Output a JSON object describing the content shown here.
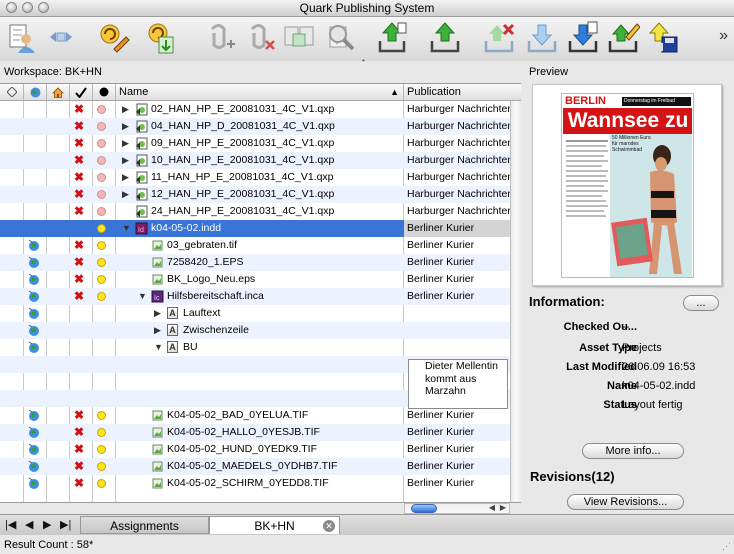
{
  "window": {
    "title": "Quark Publishing System"
  },
  "toolbar": {
    "buttons": [
      {
        "icon": "user-checklist-icon"
      },
      {
        "icon": "back-forward-icon"
      },
      {
        "icon": "refresh-edit-icon"
      },
      {
        "icon": "refresh-export-icon"
      },
      {
        "icon": "attach-add-icon"
      },
      {
        "icon": "attach-remove-icon"
      },
      {
        "icon": "compare-layout-icon"
      },
      {
        "icon": "check-document-icon"
      },
      {
        "icon": "search-icon"
      },
      {
        "icon": "check-in-upload-icon"
      },
      {
        "icon": "upload-icon"
      },
      {
        "icon": "cancel-upload-icon"
      },
      {
        "icon": "download-icon"
      },
      {
        "icon": "download-copy-icon"
      },
      {
        "icon": "edit-tray-icon"
      },
      {
        "icon": "save-upload-icon"
      }
    ],
    "more_label": "»"
  },
  "workspace_label": "Workspace: BK+HN",
  "preview_label": "Preview",
  "table": {
    "columns": {
      "name": "Name",
      "publication": "Publication"
    },
    "rows": [
      {
        "x": true,
        "dot": "pink",
        "indent": 0,
        "tri": "right",
        "icon": "qxp",
        "name": "02_HAN_HP_E_20081031_4C_V1.qxp",
        "pub": "Harburger Nachrichten"
      },
      {
        "x": true,
        "dot": "pink",
        "indent": 0,
        "tri": "right",
        "icon": "qxp",
        "name": "04_HAN_HP_D_20081031_4C_V1.qxp",
        "pub": "Harburger Nachrichten"
      },
      {
        "x": true,
        "dot": "pink",
        "indent": 0,
        "tri": "right",
        "icon": "qxp",
        "name": "09_HAN_HP_E_20081031_4C_V1.qxp",
        "pub": "Harburger Nachrichten"
      },
      {
        "x": true,
        "dot": "pink",
        "indent": 0,
        "tri": "right",
        "icon": "qxp",
        "name": "10_HAN_HP_E_20081031_4C_V1.qxp",
        "pub": "Harburger Nachrichten"
      },
      {
        "x": true,
        "dot": "pink",
        "indent": 0,
        "tri": "right",
        "icon": "qxp",
        "name": "11_HAN_HP_E_20081031_4C_V1.qxp",
        "pub": "Harburger Nachrichten"
      },
      {
        "x": true,
        "dot": "pink",
        "indent": 0,
        "tri": "right",
        "icon": "qxp",
        "name": "12_HAN_HP_E_20081031_4C_V1.qxp",
        "pub": "Harburger Nachrichten"
      },
      {
        "x": true,
        "dot": "pink",
        "indent": 0,
        "tri": "",
        "icon": "qxp",
        "name": "24_HAN_HP_E_20081031_4C_V1.qxp",
        "pub": "Harburger Nachrichten"
      },
      {
        "x": false,
        "dot": "yellow",
        "indent": 0,
        "tri": "down",
        "icon": "indd",
        "name": "k04-05-02.indd",
        "pub": "Berliner Kurier",
        "selected": true
      },
      {
        "x": true,
        "dot": "yellow",
        "indent": 1,
        "tri": "",
        "icon": "img",
        "name": "03_gebraten.tif",
        "pub": "Berliner Kurier",
        "globe": true
      },
      {
        "x": true,
        "dot": "yellow",
        "indent": 1,
        "tri": "",
        "icon": "img",
        "name": "7258420_1.EPS",
        "pub": "Berliner Kurier",
        "globe": true
      },
      {
        "x": true,
        "dot": "yellow",
        "indent": 1,
        "tri": "",
        "icon": "img",
        "name": "BK_Logo_Neu.eps",
        "pub": "Berliner Kurier",
        "globe": true
      },
      {
        "x": true,
        "dot": "yellow",
        "indent": 1,
        "tri": "down",
        "icon": "inca",
        "name": "Hilfsbereitschaft.inca",
        "pub": "Berliner Kurier",
        "globe": true
      },
      {
        "x": false,
        "dot": "",
        "indent": 2,
        "tri": "right",
        "icon": "a",
        "name": "Lauftext",
        "pub": "",
        "globe": true
      },
      {
        "x": false,
        "dot": "",
        "indent": 2,
        "tri": "right",
        "icon": "a",
        "name": "Zwischenzeile",
        "pub": "",
        "globe": true
      },
      {
        "x": false,
        "dot": "",
        "indent": 2,
        "tri": "down",
        "icon": "a",
        "name": "BU",
        "pub": "",
        "globe": true
      },
      {
        "spacer": true
      },
      {
        "spacer": true
      },
      {
        "spacer": true
      },
      {
        "x": true,
        "dot": "yellow",
        "indent": 1,
        "tri": "",
        "icon": "img",
        "name": "K04-05-02_BAD_0YELUA.TIF",
        "pub": "Berliner Kurier",
        "globe": true
      },
      {
        "x": true,
        "dot": "yellow",
        "indent": 1,
        "tri": "",
        "icon": "img",
        "name": "K04-05-02_HALLO_0YESJB.TIF",
        "pub": "Berliner Kurier",
        "globe": true
      },
      {
        "x": true,
        "dot": "yellow",
        "indent": 1,
        "tri": "",
        "icon": "img",
        "name": "K04-05-02_HUND_0YEDK9.TIF",
        "pub": "Berliner Kurier",
        "globe": true
      },
      {
        "x": true,
        "dot": "yellow",
        "indent": 1,
        "tri": "",
        "icon": "img",
        "name": "K04-05-02_MAEDELS_0YDHB7.TIF",
        "pub": "Berliner Kurier",
        "globe": true
      },
      {
        "x": true,
        "dot": "yellow",
        "indent": 1,
        "tri": "",
        "icon": "img",
        "name": "K04-05-02_SCHIRM_0YEDD8.TIF",
        "pub": "Berliner Kurier",
        "globe": true
      }
    ],
    "note": "Dieter Mellentin kommt aus Marzahn"
  },
  "preview": {
    "masthead": "BERLIN",
    "tagline": "Donnerstag im Freibad",
    "headline": "Wannsee zu",
    "subhead": "50 Millionen Euro für marodes Schwimmbad"
  },
  "info": {
    "title": "Information:",
    "more_button": "...",
    "fields": [
      {
        "key": "Checked Ou...",
        "value": "--"
      },
      {
        "key": "Asset Type",
        "value": "Projects"
      },
      {
        "key": "Last Modified",
        "value": "26.06.09 16:53"
      },
      {
        "key": "Name",
        "value": "k04-05-02.indd"
      },
      {
        "key": "Status",
        "value": "Layout fertig"
      }
    ],
    "more_info_button": "More info..."
  },
  "revisions": {
    "title": "Revisions(12)",
    "button": "View Revisions..."
  },
  "tabs": [
    {
      "label": "Assignments",
      "active": false
    },
    {
      "label": "BK+HN",
      "active": true
    }
  ],
  "status": {
    "result_count": "Result Count : 58*"
  }
}
